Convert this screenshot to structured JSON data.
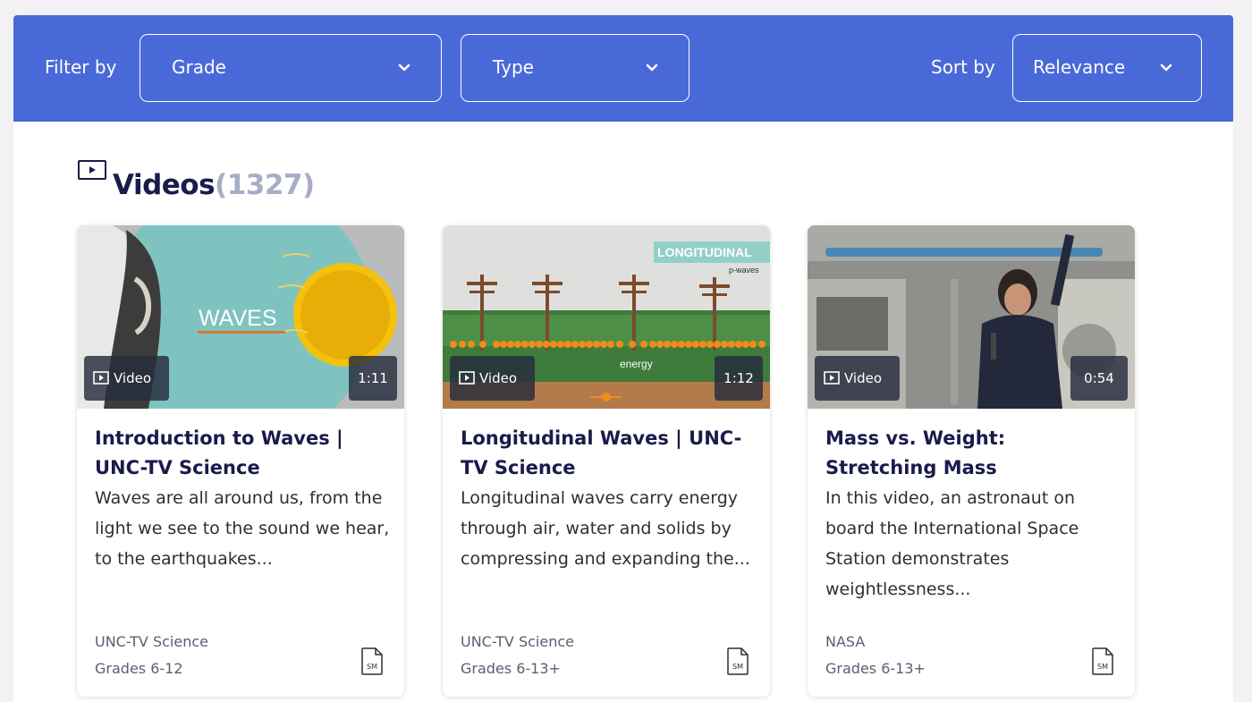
{
  "filters": {
    "filter_by_label": "Filter by",
    "grade": {
      "value": "Grade"
    },
    "type": {
      "value": "Type"
    },
    "sort_by_label": "Sort by",
    "sort": {
      "value": "Relevance"
    }
  },
  "section": {
    "title": "Videos",
    "count": "(1327)",
    "icon": "play-square-icon"
  },
  "colors": {
    "filter_bar": "#4a69d9",
    "heading": "#1a1b4b",
    "count": "#a8acc7"
  },
  "cards": [
    {
      "badge": "Video",
      "duration": "1:11",
      "title": "Introduction to Waves | UNC-TV Science",
      "description": "Waves are all around us, from the light we see to the sound we hear, to the earthquakes...",
      "source": "UNC-TV Science",
      "grades": "Grades 6-12",
      "thumbnail_text": "WAVES",
      "icon": "sm-file-icon"
    },
    {
      "badge": "Video",
      "duration": "1:12",
      "title": "Longitudinal Waves | UNC-TV Science",
      "description": "Longitudinal waves carry energy through air, water and solids by compressing and expanding the...",
      "source": "UNC-TV Science",
      "grades": "Grades 6-13+",
      "thumbnail_text": "LONGITUDINAL",
      "thumbnail_subtext": "p-waves",
      "thumbnail_label": "energy",
      "icon": "sm-file-icon"
    },
    {
      "badge": "Video",
      "duration": "0:54",
      "title": "Mass vs. Weight: Stretching Mass",
      "description": "In this video, an astronaut on board the International Space Station demonstrates weightlessness...",
      "source": "NASA",
      "grades": "Grades 6-13+",
      "icon": "sm-file-icon"
    }
  ]
}
